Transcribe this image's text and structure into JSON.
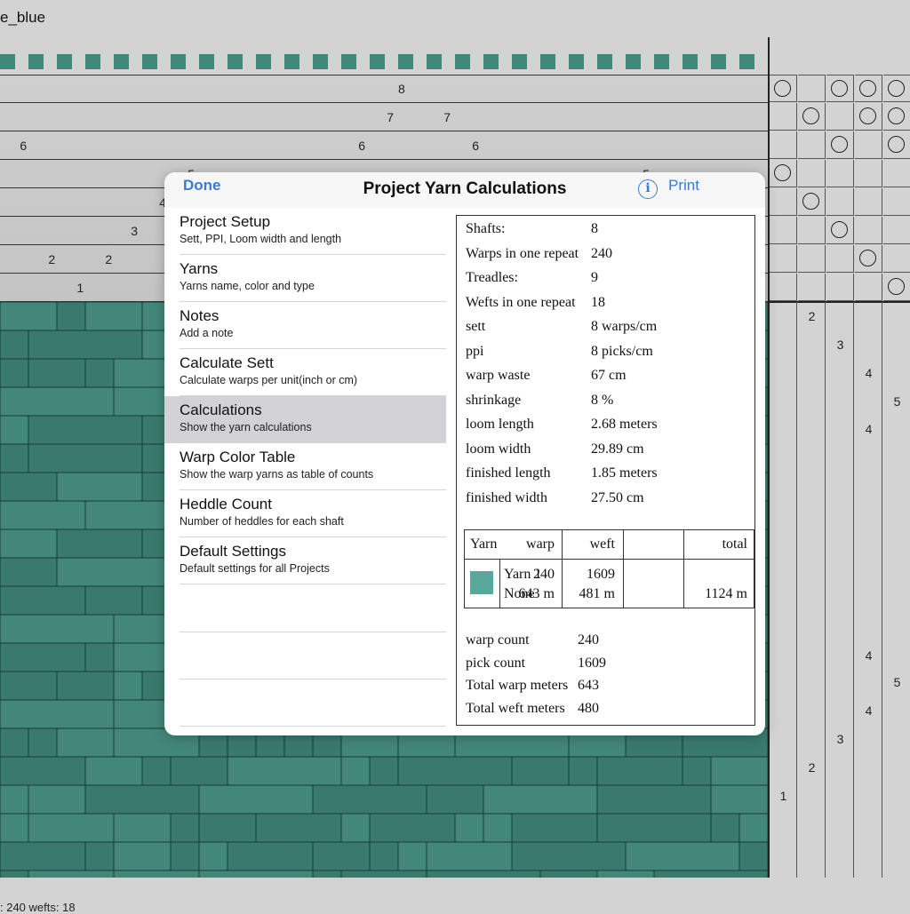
{
  "window_title": "e_blue",
  "status_bar": ": 240   wefts: 18",
  "threading_numbers": [
    {
      "row": 0,
      "labels": [
        "8"
      ],
      "cols": [
        14
      ]
    },
    {
      "row": 1,
      "labels": [
        "7",
        "7"
      ],
      "cols": [
        13.6,
        15.6
      ]
    },
    {
      "row": 2,
      "labels": [
        "6",
        "6",
        "6"
      ],
      "cols": [
        0.7,
        12.6,
        16.6
      ]
    },
    {
      "row": 3,
      "labels": [
        "5",
        "5"
      ],
      "cols": [
        6.6,
        22.6
      ]
    },
    {
      "row": 4,
      "labels": [
        "4"
      ],
      "cols": [
        5.6
      ]
    },
    {
      "row": 5,
      "labels": [
        "3"
      ],
      "cols": [
        4.6
      ]
    },
    {
      "row": 6,
      "labels": [
        "2",
        "2"
      ],
      "cols": [
        1.7,
        3.7
      ]
    },
    {
      "row": 7,
      "labels": [
        "1"
      ],
      "cols": [
        2.7
      ]
    }
  ],
  "treadling_numbers": [
    {
      "col": 1,
      "label": "2"
    },
    {
      "col": 2,
      "label": "3"
    },
    {
      "col": 3,
      "label": "4"
    },
    {
      "col": 3,
      "label": "4"
    },
    {
      "col": 4,
      "label": "5"
    },
    {
      "col": 3,
      "label": "4"
    },
    {
      "col": 4,
      "label": "5"
    },
    {
      "col": 3,
      "label": "4"
    },
    {
      "col": 2,
      "label": "3"
    },
    {
      "col": 1,
      "label": "2"
    },
    {
      "col": 0,
      "label": "1"
    }
  ],
  "colors": {
    "cloth": "#43877a",
    "cloth_dark": "#3a7a6e",
    "yarn1": "#5aa89b",
    "accent": "#3a7bd5",
    "selected_row": "#d2d2d6"
  },
  "modal": {
    "title": "Project Yarn Calculations",
    "done_label": "Done",
    "print_label": "Print",
    "info_icon_glyph": "i",
    "menu": [
      {
        "title": "Project Setup",
        "subtitle": "Sett, PPI, Loom width and length"
      },
      {
        "title": "Yarns",
        "subtitle": "Yarns name, color and type"
      },
      {
        "title": "Notes",
        "subtitle": "Add a note"
      },
      {
        "title": "Calculate Sett",
        "subtitle": "Calculate warps per unit(inch or cm)"
      },
      {
        "title": "Calculations",
        "subtitle": "Show the yarn calculations",
        "selected": true
      },
      {
        "title": "Warp Color Table",
        "subtitle": "Show the warp yarns as table of counts"
      },
      {
        "title": "Heddle Count",
        "subtitle": "Number of heddles for each shaft"
      },
      {
        "title": "Default Settings",
        "subtitle": "Default settings for all Projects"
      }
    ],
    "report": {
      "rows": [
        {
          "label": "Shafts:",
          "value": "8"
        },
        {
          "label": "Warps in one repeat",
          "value": "240"
        },
        {
          "label": "Treadles:",
          "value": "9"
        },
        {
          "label": "Wefts in one repeat",
          "value": "18"
        },
        {
          "label": "sett",
          "value": "8 warps/cm"
        },
        {
          "label": "ppi",
          "value": "8 picks/cm"
        },
        {
          "label": "warp waste",
          "value": "67 cm"
        },
        {
          "label": "shrinkage",
          "value": "8 %"
        },
        {
          "label": "loom length",
          "value": "2.68 meters"
        },
        {
          "label": "loom width",
          "value": "29.89 cm"
        },
        {
          "label": "finished length",
          "value": "1.85 meters"
        },
        {
          "label": "finished width",
          "value": "27.50 cm"
        }
      ],
      "yarn_table": {
        "headers": {
          "yarn": "Yarn",
          "warp": "warp",
          "weft": "weft",
          "total": "total"
        },
        "rows": [
          {
            "name": "Yarn 1",
            "type": "None",
            "warp_count": "240",
            "warp_len": "643 m",
            "weft_count": "1609",
            "weft_len": "481 m",
            "total": "1124 m"
          }
        ]
      },
      "summary": [
        {
          "label": "warp count",
          "value": "240"
        },
        {
          "label": "pick count",
          "value": "1609"
        },
        {
          "label": "Total warp meters",
          "value": "643"
        },
        {
          "label": "Total weft meters",
          "value": "480"
        }
      ]
    }
  }
}
